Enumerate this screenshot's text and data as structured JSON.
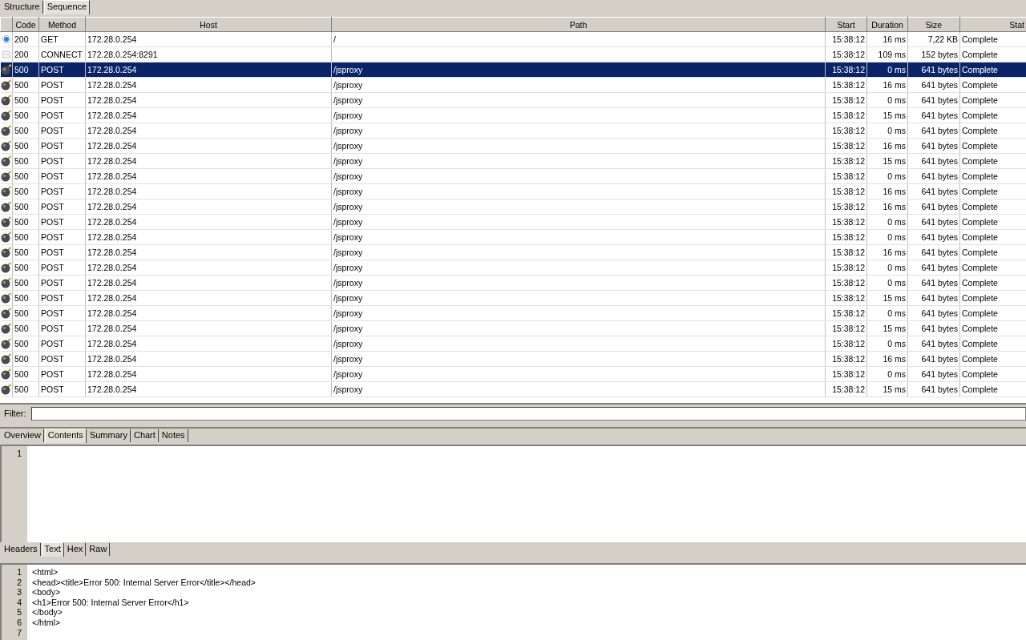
{
  "tabs": [
    {
      "label": "Structure",
      "selected": false
    },
    {
      "label": "Sequence",
      "selected": true
    }
  ],
  "table": {
    "columns": [
      "Code",
      "Method",
      "Host",
      "Path",
      "Start",
      "Duration",
      "Size",
      "Stat"
    ],
    "rows": [
      {
        "kind": "info",
        "code": "200",
        "method": "GET",
        "host": "172.28.0.254",
        "path": "/",
        "start": "15:38:12",
        "duration": "16 ms",
        "size": "7,22 KB",
        "status": "Complete",
        "selected": false
      },
      {
        "kind": "document",
        "code": "200",
        "method": "CONNECT",
        "host": "172.28.0.254:8291",
        "start": "15:38:12",
        "duration": "109 ms",
        "size": "152 bytes",
        "status": "Complete",
        "selected": false
      },
      {
        "kind": "error",
        "code": "500",
        "method": "POST",
        "host": "172.28.0.254",
        "path": "/jsproxy",
        "start": "15:38:12",
        "duration": "0 ms",
        "size": "641 bytes",
        "status": "Complete",
        "selected": true
      },
      {
        "kind": "error",
        "code": "500",
        "method": "POST",
        "host": "172.28.0.254",
        "path": "/jsproxy",
        "start": "15:38:12",
        "duration": "16 ms",
        "size": "641 bytes",
        "status": "Complete",
        "selected": false
      },
      {
        "kind": "error",
        "code": "500",
        "method": "POST",
        "host": "172.28.0.254",
        "path": "/jsproxy",
        "start": "15:38:12",
        "duration": "0 ms",
        "size": "641 bytes",
        "status": "Complete",
        "selected": false
      },
      {
        "kind": "error",
        "code": "500",
        "method": "POST",
        "host": "172.28.0.254",
        "path": "/jsproxy",
        "start": "15:38:12",
        "duration": "15 ms",
        "size": "641 bytes",
        "status": "Complete",
        "selected": false
      },
      {
        "kind": "error",
        "code": "500",
        "method": "POST",
        "host": "172.28.0.254",
        "path": "/jsproxy",
        "start": "15:38:12",
        "duration": "0 ms",
        "size": "641 bytes",
        "status": "Complete",
        "selected": false
      },
      {
        "kind": "error",
        "code": "500",
        "method": "POST",
        "host": "172.28.0.254",
        "path": "/jsproxy",
        "start": "15:38:12",
        "duration": "16 ms",
        "size": "641 bytes",
        "status": "Complete",
        "selected": false
      },
      {
        "kind": "error",
        "code": "500",
        "method": "POST",
        "host": "172.28.0.254",
        "path": "/jsproxy",
        "start": "15:38:12",
        "duration": "15 ms",
        "size": "641 bytes",
        "status": "Complete",
        "selected": false
      },
      {
        "kind": "error",
        "code": "500",
        "method": "POST",
        "host": "172.28.0.254",
        "path": "/jsproxy",
        "start": "15:38:12",
        "duration": "0 ms",
        "size": "641 bytes",
        "status": "Complete",
        "selected": false
      },
      {
        "kind": "error",
        "code": "500",
        "method": "POST",
        "host": "172.28.0.254",
        "path": "/jsproxy",
        "start": "15:38:12",
        "duration": "16 ms",
        "size": "641 bytes",
        "status": "Complete",
        "selected": false
      },
      {
        "kind": "error",
        "code": "500",
        "method": "POST",
        "host": "172.28.0.254",
        "path": "/jsproxy",
        "start": "15:38:12",
        "duration": "16 ms",
        "size": "641 bytes",
        "status": "Complete",
        "selected": false
      },
      {
        "kind": "error",
        "code": "500",
        "method": "POST",
        "host": "172.28.0.254",
        "path": "/jsproxy",
        "start": "15:38:12",
        "duration": "0 ms",
        "size": "641 bytes",
        "status": "Complete",
        "selected": false
      },
      {
        "kind": "error",
        "code": "500",
        "method": "POST",
        "host": "172.28.0.254",
        "path": "/jsproxy",
        "start": "15:38:12",
        "duration": "0 ms",
        "size": "641 bytes",
        "status": "Complete",
        "selected": false
      },
      {
        "kind": "error",
        "code": "500",
        "method": "POST",
        "host": "172.28.0.254",
        "path": "/jsproxy",
        "start": "15:38:12",
        "duration": "16 ms",
        "size": "641 bytes",
        "status": "Complete",
        "selected": false
      },
      {
        "kind": "error",
        "code": "500",
        "method": "POST",
        "host": "172.28.0.254",
        "path": "/jsproxy",
        "start": "15:38:12",
        "duration": "0 ms",
        "size": "641 bytes",
        "status": "Complete",
        "selected": false
      },
      {
        "kind": "error",
        "code": "500",
        "method": "POST",
        "host": "172.28.0.254",
        "path": "/jsproxy",
        "start": "15:38:12",
        "duration": "0 ms",
        "size": "641 bytes",
        "status": "Complete",
        "selected": false
      },
      {
        "kind": "error",
        "code": "500",
        "method": "POST",
        "host": "172.28.0.254",
        "path": "/jsproxy",
        "start": "15:38:12",
        "duration": "15 ms",
        "size": "641 bytes",
        "status": "Complete",
        "selected": false
      },
      {
        "kind": "error",
        "code": "500",
        "method": "POST",
        "host": "172.28.0.254",
        "path": "/jsproxy",
        "start": "15:38:12",
        "duration": "0 ms",
        "size": "641 bytes",
        "status": "Complete",
        "selected": false
      },
      {
        "kind": "error",
        "code": "500",
        "method": "POST",
        "host": "172.28.0.254",
        "path": "/jsproxy",
        "start": "15:38:12",
        "duration": "15 ms",
        "size": "641 bytes",
        "status": "Complete",
        "selected": false
      },
      {
        "kind": "error",
        "code": "500",
        "method": "POST",
        "host": "172.28.0.254",
        "path": "/jsproxy",
        "start": "15:38:12",
        "duration": "0 ms",
        "size": "641 bytes",
        "status": "Complete",
        "selected": false
      },
      {
        "kind": "error",
        "code": "500",
        "method": "POST",
        "host": "172.28.0.254",
        "path": "/jsproxy",
        "start": "15:38:12",
        "duration": "16 ms",
        "size": "641 bytes",
        "status": "Complete",
        "selected": false
      },
      {
        "kind": "error",
        "code": "500",
        "method": "POST",
        "host": "172.28.0.254",
        "path": "/jsproxy",
        "start": "15:38:12",
        "duration": "0 ms",
        "size": "641 bytes",
        "status": "Complete",
        "selected": false
      },
      {
        "kind": "error",
        "code": "500",
        "method": "POST",
        "host": "172.28.0.254",
        "path": "/jsproxy",
        "start": "15:38:12",
        "duration": "15 ms",
        "size": "641 bytes",
        "status": "Complete",
        "selected": false
      }
    ]
  },
  "filter": {
    "label": "Filter:"
  },
  "detail_tabs": [
    {
      "label": "Overview",
      "selected": false
    },
    {
      "label": "Contents",
      "selected": true
    },
    {
      "label": "Summary",
      "selected": false
    },
    {
      "label": "Chart",
      "selected": false
    },
    {
      "label": "Notes",
      "selected": false
    }
  ],
  "request_body": {
    "lines": [
      {
        "number": "1"
      }
    ]
  },
  "body_tabs": [
    {
      "label": "Headers",
      "selected": false
    },
    {
      "label": "Text",
      "selected": true
    },
    {
      "label": "Hex",
      "selected": false
    },
    {
      "label": "Raw",
      "selected": false
    }
  ],
  "response_body": {
    "lines": [
      {
        "number": "1",
        "text": "<html>"
      },
      {
        "number": "2",
        "text": "<head><title>Error 500: Internal Server Error</title></head>"
      },
      {
        "number": "3",
        "text": "<body>"
      },
      {
        "number": "4",
        "text": "<h1>Error 500: Internal Server Error</h1>"
      },
      {
        "number": "5",
        "text": "</body>"
      },
      {
        "number": "6",
        "text": "</html>"
      },
      {
        "number": "7"
      }
    ]
  }
}
